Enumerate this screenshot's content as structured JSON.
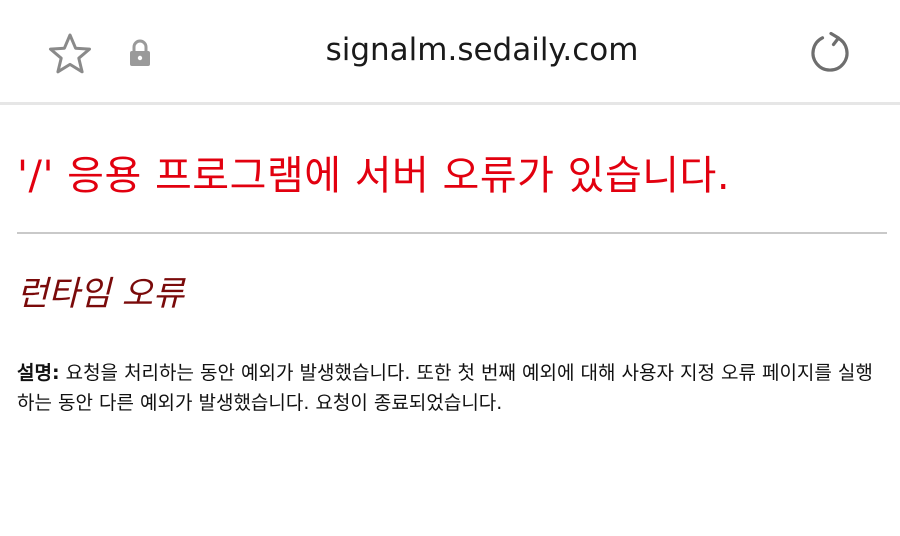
{
  "browser": {
    "url": "signalm.sedaily.com",
    "icons": {
      "bookmark": "star-outline-icon",
      "security": "lock-icon",
      "reload": "reload-icon"
    },
    "colors": {
      "icon_gray": "#8a8a8a",
      "divider": "#e6e6e6"
    }
  },
  "page": {
    "title": "'/' 응용 프로그램에 서버 오류가 있습니다.",
    "subtitle": "런타임 오류",
    "description_label": "설명:",
    "description_text": " 요청을 처리하는 동안 예외가 발생했습니다. 또한 첫 번째 예외에 대해 사용자 지정 오류 페이지를 실행하는 동안 다른 예외가 발생했습니다. 요청이 종료되었습니다.",
    "colors": {
      "title": "#e2000f",
      "subtitle": "#7a0a0a",
      "rule": "#c9c9c9"
    }
  }
}
